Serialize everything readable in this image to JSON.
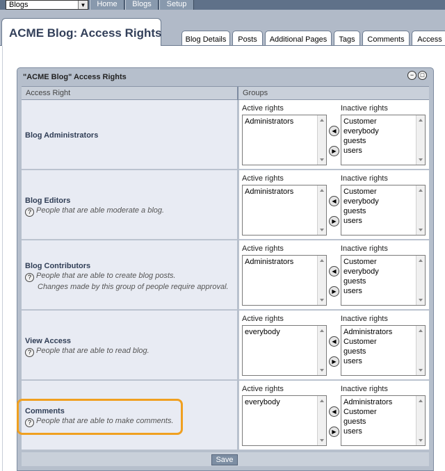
{
  "topbar": {
    "selector_value": "Blogs",
    "nav": [
      "Home",
      "Blogs",
      "Setup"
    ]
  },
  "page": {
    "title": "ACME Blog: Access Rights"
  },
  "tabs": [
    "Blog Details",
    "Posts",
    "Additional Pages",
    "Tags",
    "Comments",
    "Access"
  ],
  "panel": {
    "title": "\"ACME Blog\" Access Rights",
    "col_access_right": "Access Right",
    "col_groups": "Groups",
    "active_label": "Active rights",
    "inactive_label": "Inactive rights",
    "save_label": "Save"
  },
  "rows": [
    {
      "name": "Blog Administrators",
      "desc": "",
      "desc2": "",
      "active": [
        "Administrators"
      ],
      "inactive": [
        "Customer",
        "everybody",
        "guests",
        "users"
      ]
    },
    {
      "name": "Blog Editors",
      "desc": "People that are able moderate a blog.",
      "desc2": "",
      "active": [
        "Administrators"
      ],
      "inactive": [
        "Customer",
        "everybody",
        "guests",
        "users"
      ]
    },
    {
      "name": "Blog Contributors",
      "desc": "People that are able to create blog posts.",
      "desc2": "Changes made by this group of people require approval.",
      "active": [
        "Administrators"
      ],
      "inactive": [
        "Customer",
        "everybody",
        "guests",
        "users"
      ]
    },
    {
      "name": "View Access",
      "desc": "People that are able to read blog.",
      "desc2": "",
      "active": [
        "everybody"
      ],
      "inactive": [
        "Administrators",
        "Customer",
        "guests",
        "users"
      ]
    },
    {
      "name": "Comments",
      "desc": "People that are able to make comments.",
      "desc2": "",
      "active": [
        "everybody"
      ],
      "inactive": [
        "Administrators",
        "Customer",
        "guests",
        "users"
      ]
    }
  ],
  "colors": {
    "highlight": "#f0a020",
    "header_bg": "#b1bac8",
    "panel_bg": "#b6bfcc"
  }
}
